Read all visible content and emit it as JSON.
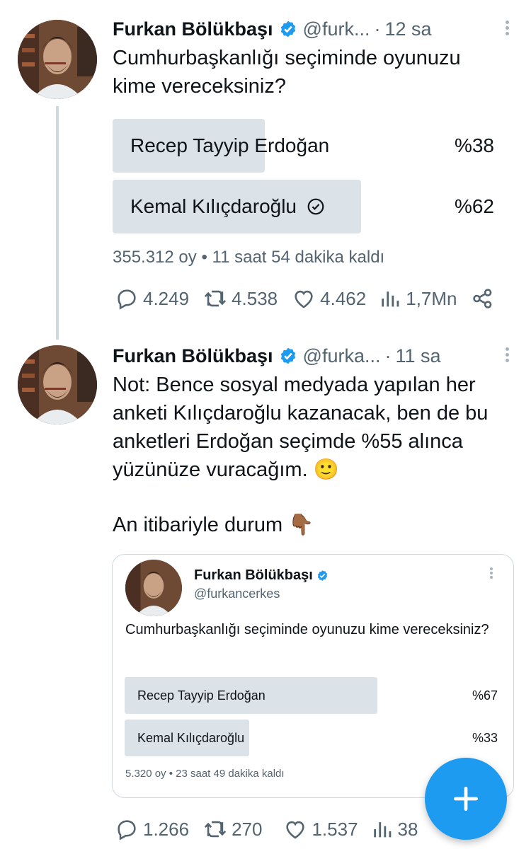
{
  "tweets": [
    {
      "author": "Furkan Bölükbaşı",
      "handle": "@furk...",
      "time": "12 sa",
      "text": "Cumhurbaşkanlığı seçiminde oyunuzu kime vereceksiniz?",
      "poll": {
        "options": [
          {
            "label": "Recep Tayyip Erdoğan",
            "percent_text": "%38",
            "percent": 38,
            "selected": false
          },
          {
            "label": "Kemal Kılıçdaroğlu",
            "percent_text": "%62",
            "percent": 62,
            "selected": true
          }
        ],
        "meta": "355.312 oy • 11 saat 54 dakika kaldı"
      },
      "actions": {
        "replies": "4.249",
        "retweets": "4.538",
        "likes": "4.462",
        "views": "1,7Mn"
      }
    },
    {
      "author": "Furkan Bölükbaşı",
      "handle": "@furka...",
      "time": "11 sa",
      "text": "Not: Bence sosyal medyada yapılan her anketi Kılıçdaroğlu kazanacak, ben de bu anketleri Erdoğan seçimde %55 alınca yüzünüze vuracağım. 🙂",
      "text2": "An itibariyle durum 👇🏾",
      "actions": {
        "replies": "1.266",
        "retweets": "270",
        "likes": "1.537",
        "views": "38"
      }
    }
  ],
  "embed": {
    "author": "Furkan Bölükbaşı",
    "handle": "@furkancerkes",
    "text": "Cumhurbaşkanlığı seçiminde oyunuzu kime vereceksiniz?",
    "poll": {
      "options": [
        {
          "label": "Recep Tayyip Erdoğan",
          "percent_text": "%67",
          "percent": 67
        },
        {
          "label": "Kemal Kılıçdaroğlu",
          "percent_text": "%33",
          "percent": 33
        }
      ],
      "meta": "5.320 oy • 23 saat 49 dakika kaldı"
    }
  },
  "colors": {
    "accent": "#1d9bf0",
    "muted": "#536471",
    "poll_bar": "#dbe2e8"
  },
  "icons": [
    "verified-badge-icon",
    "more-icon",
    "reply-icon",
    "retweet-icon",
    "like-icon",
    "views-icon",
    "share-icon",
    "check-circle-icon",
    "plus-icon"
  ]
}
